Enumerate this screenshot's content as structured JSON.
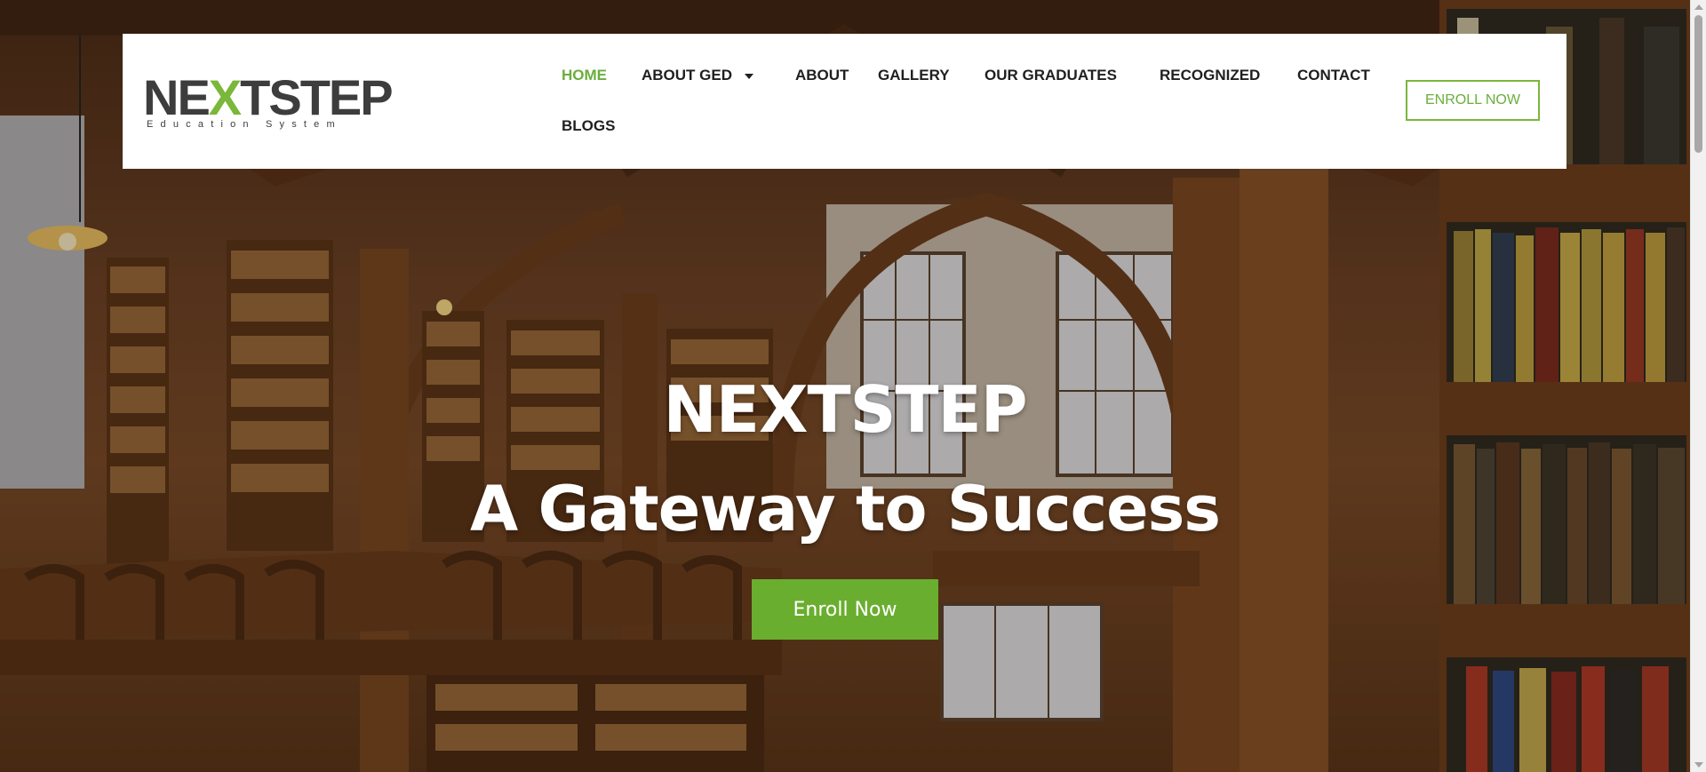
{
  "brand": {
    "logo_word_before": "NE",
    "logo_word_x": "X",
    "logo_word_after": "TSTEP",
    "logo_tagline": "Education System",
    "accent_color": "#7ab73a"
  },
  "nav": {
    "items": [
      {
        "label": "HOME",
        "active": true
      },
      {
        "label": "ABOUT GED",
        "has_dropdown": true
      },
      {
        "label": "ABOUT"
      },
      {
        "label": "GALLERY"
      },
      {
        "label": "OUR GRADUATES"
      },
      {
        "label": "RECOGNIZED"
      },
      {
        "label": "CONTACT"
      },
      {
        "label": "BLOGS"
      }
    ],
    "enroll_label": "ENROLL NOW"
  },
  "hero": {
    "title": "NEXTSTEP",
    "subtitle": "A Gateway to Success",
    "cta_label": "Enroll Now",
    "cta_color": "#6aae2f"
  },
  "icons": {
    "dropdown": "chevron-down-icon",
    "scroll_up": "arrow-up-icon",
    "scroll_down": "arrow-down-icon"
  }
}
